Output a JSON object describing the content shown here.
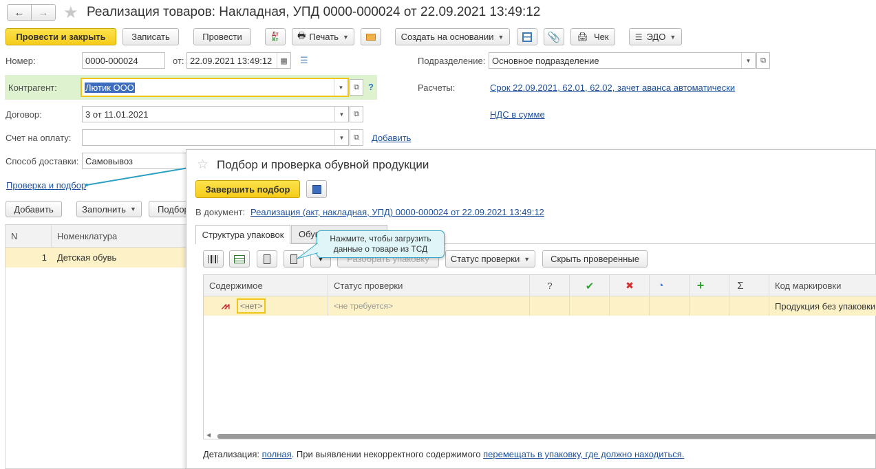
{
  "window": {
    "title": "Реализация товаров: Накладная, УПД 0000-000024 от 22.09.2021 13:49:12"
  },
  "toolbar": {
    "post_close": "Провести и закрыть",
    "save": "Записать",
    "post": "Провести",
    "dtkt": "Дт/Кт",
    "print": "Печать",
    "create_based": "Создать на основании",
    "check": "Чек",
    "edo": "ЭДО"
  },
  "form": {
    "number_label": "Номер:",
    "number_value": "0000-000024",
    "date_from_label": "от:",
    "date_value": "22.09.2021 13:49:12",
    "dept_label": "Подразделение:",
    "dept_value": "Основное подразделение",
    "counterparty_label": "Контрагент:",
    "counterparty_value": "Лютик ООО",
    "help": "?",
    "settlements_label": "Расчеты:",
    "settlements_link": "Срок 22.09.2021, 62.01, 62.02, зачет аванса автоматически",
    "contract_label": "Договор:",
    "contract_value": "3 от 11.01.2021",
    "vat_link": "НДС в сумме",
    "invoice_label": "Счет на оплату:",
    "invoice_value": "",
    "add_link": "Добавить",
    "delivery_label": "Способ доставки:",
    "delivery_value": "Самовывоз",
    "check_link": "Проверка и подбор"
  },
  "goods": {
    "add_button": "Добавить",
    "fill_button": "Заполнить",
    "pick_button": "Подбор",
    "col_n": "N",
    "col_item": "Номенклатура",
    "rows": [
      {
        "n": "1",
        "item": "Детская обувь"
      }
    ]
  },
  "dialog": {
    "title": "Подбор и проверка обувной продукции",
    "finish_button": "Завершить подбор",
    "doc_label": "В документ:",
    "doc_link": "Реализация (акт, накладная, УПД) 0000-000024 от 22.09.2021 13:49:12",
    "tab_structure": "Структура упаковок",
    "tab_other": "Обувь",
    "tooltip": "Нажмите, чтобы загрузить данные о товаре из ТСД",
    "disassemble_button": "Разобрать упаковку",
    "status_button": "Статус проверки",
    "hide_button": "Скрыть проверенные",
    "columns": {
      "content": "Содержимое",
      "status": "Статус проверки",
      "q": "?",
      "ok": "✔",
      "bad": "✖",
      "half": "◔",
      "plus": "+",
      "sum": "Σ",
      "code": "Код маркировки"
    },
    "rows": [
      {
        "content": "<нет>",
        "status": "<не требуется>",
        "code": "Продукция без упаковки"
      }
    ],
    "footer_prefix": "Детализация:",
    "footer_link1": "полная",
    "footer_mid": ". При выявлении некорректного содержимого",
    "footer_link2": "перемещать в упаковку, где должно находиться."
  },
  "colors": {
    "accent_yellow": "#f5cc1a",
    "link": "#1c4f9c",
    "highlight_row": "#fdf1c7",
    "counterparty_bg": "#dff2d0",
    "tooltip_bg": "#dff5f7",
    "arrow": "#2a9fc2"
  }
}
